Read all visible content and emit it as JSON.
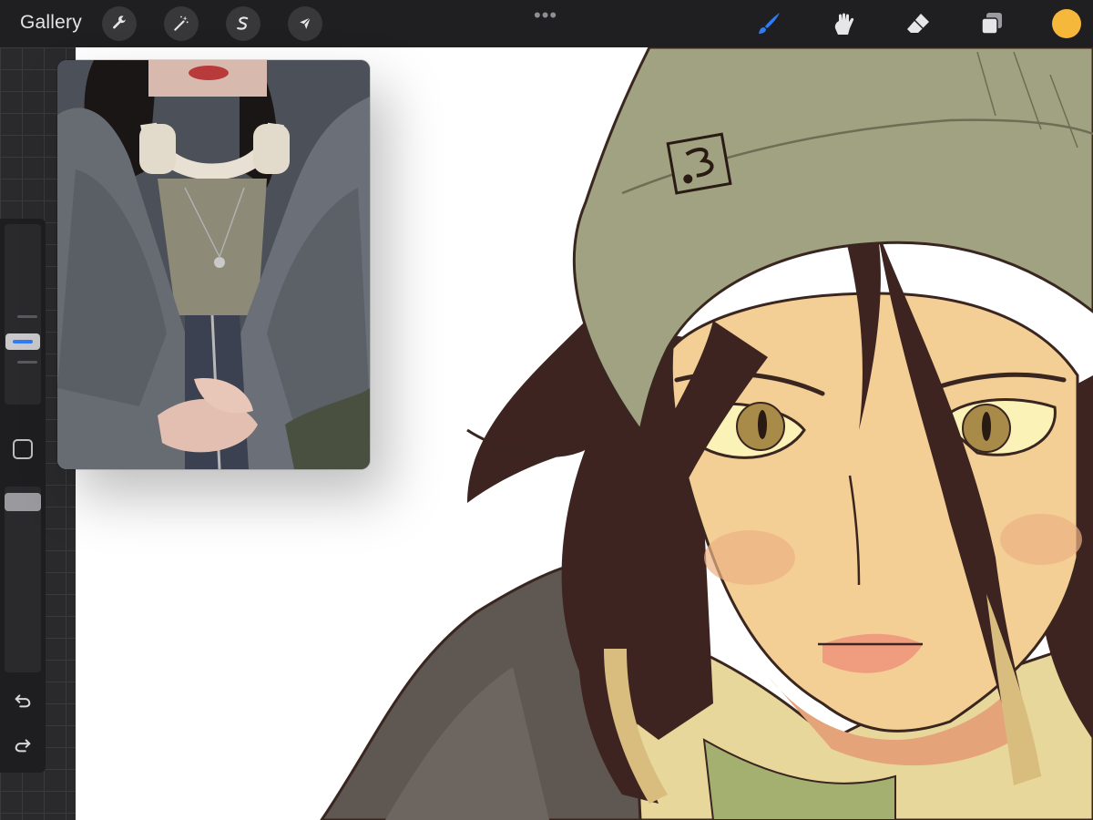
{
  "toolbar": {
    "gallery_label": "Gallery",
    "left_tools": [
      {
        "name": "adjustments",
        "icon": "wrench-icon"
      },
      {
        "name": "selection-magic",
        "icon": "magic-wand-icon"
      },
      {
        "name": "selection",
        "icon": "s-selection-icon"
      },
      {
        "name": "transform",
        "icon": "arrow-cursor-icon"
      }
    ],
    "more_label": "•••",
    "right_tools": [
      {
        "name": "brush",
        "icon": "brush-icon",
        "active": true
      },
      {
        "name": "smudge",
        "icon": "smudge-icon"
      },
      {
        "name": "eraser",
        "icon": "eraser-icon"
      },
      {
        "name": "layers",
        "icon": "layers-icon"
      }
    ],
    "current_color": "#f5b83a",
    "active_color": "#2f7cf6"
  },
  "sidebar": {
    "brush_size_level": 0.38,
    "opacity_level": 0.96
  },
  "reference": {
    "description_icon": "reference-photo"
  }
}
